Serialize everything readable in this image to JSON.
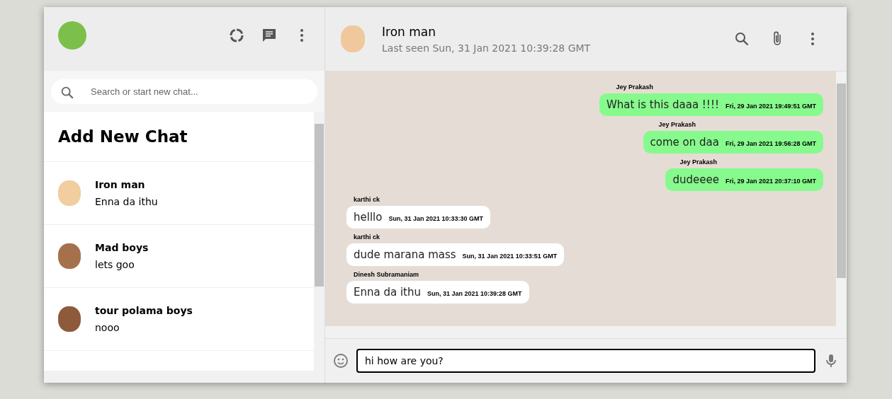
{
  "sidebar": {
    "search": {
      "placeholder": "Search or start new chat..."
    },
    "add_chat_title": "Add New Chat",
    "chats": [
      {
        "name": "Iron man",
        "last_message": "Enna da ithu",
        "color": "#f2cda0"
      },
      {
        "name": "Mad boys",
        "last_message": "lets goo",
        "color": "#a5714c"
      },
      {
        "name": "tour polama boys",
        "last_message": "nooo",
        "color": "#8e5a3c"
      }
    ]
  },
  "chat": {
    "name": "Iron man",
    "last_seen": "Last seen Sun, 31 Jan 2021 10:39:28 GMT",
    "messages": [
      {
        "sender": "Jey Prakash",
        "text": "What is this daaa !!!!",
        "time": "Fri, 29 Jan 2021 19:49:51 GMT",
        "kind": "sent"
      },
      {
        "sender": "Jey Prakash",
        "text": "come on daa",
        "time": "Fri, 29 Jan 2021 19:56:28 GMT",
        "kind": "sent"
      },
      {
        "sender": "Jey Prakash",
        "text": "dudeeee",
        "time": "Fri, 29 Jan 2021 20:37:10 GMT",
        "kind": "sent"
      },
      {
        "sender": "karthi ck",
        "text": "helllo",
        "time": "Sun, 31 Jan 2021 10:33:30 GMT",
        "kind": "received"
      },
      {
        "sender": "karthi ck",
        "text": "dude marana mass",
        "time": "Sun, 31 Jan 2021 10:33:51 GMT",
        "kind": "received"
      },
      {
        "sender": "Dinesh Subramaniam",
        "text": "Enna da ithu",
        "time": "Sun, 31 Jan 2021 10:39:28 GMT",
        "kind": "received"
      }
    ],
    "input": {
      "value": "hi how are you?"
    }
  }
}
